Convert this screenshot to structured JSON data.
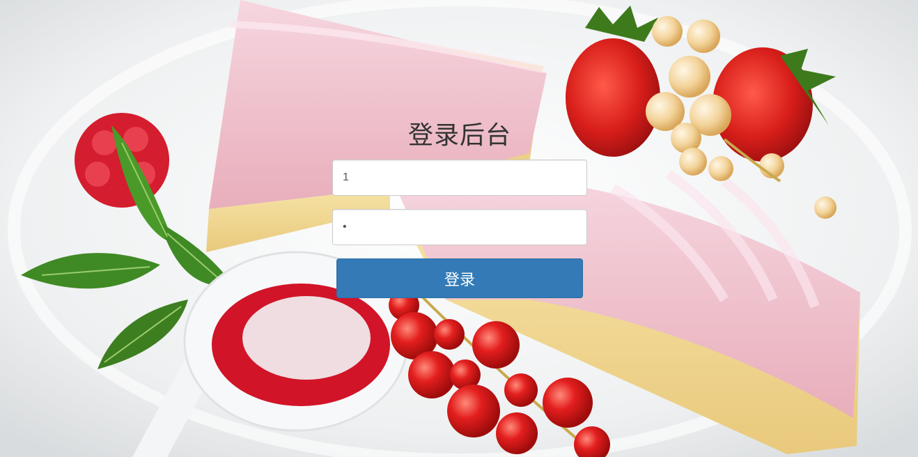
{
  "login": {
    "title": "登录后台",
    "username_value": "1",
    "password_value": "1",
    "submit_label": "登录"
  },
  "colors": {
    "button": "#337ab7",
    "title": "#333333"
  }
}
